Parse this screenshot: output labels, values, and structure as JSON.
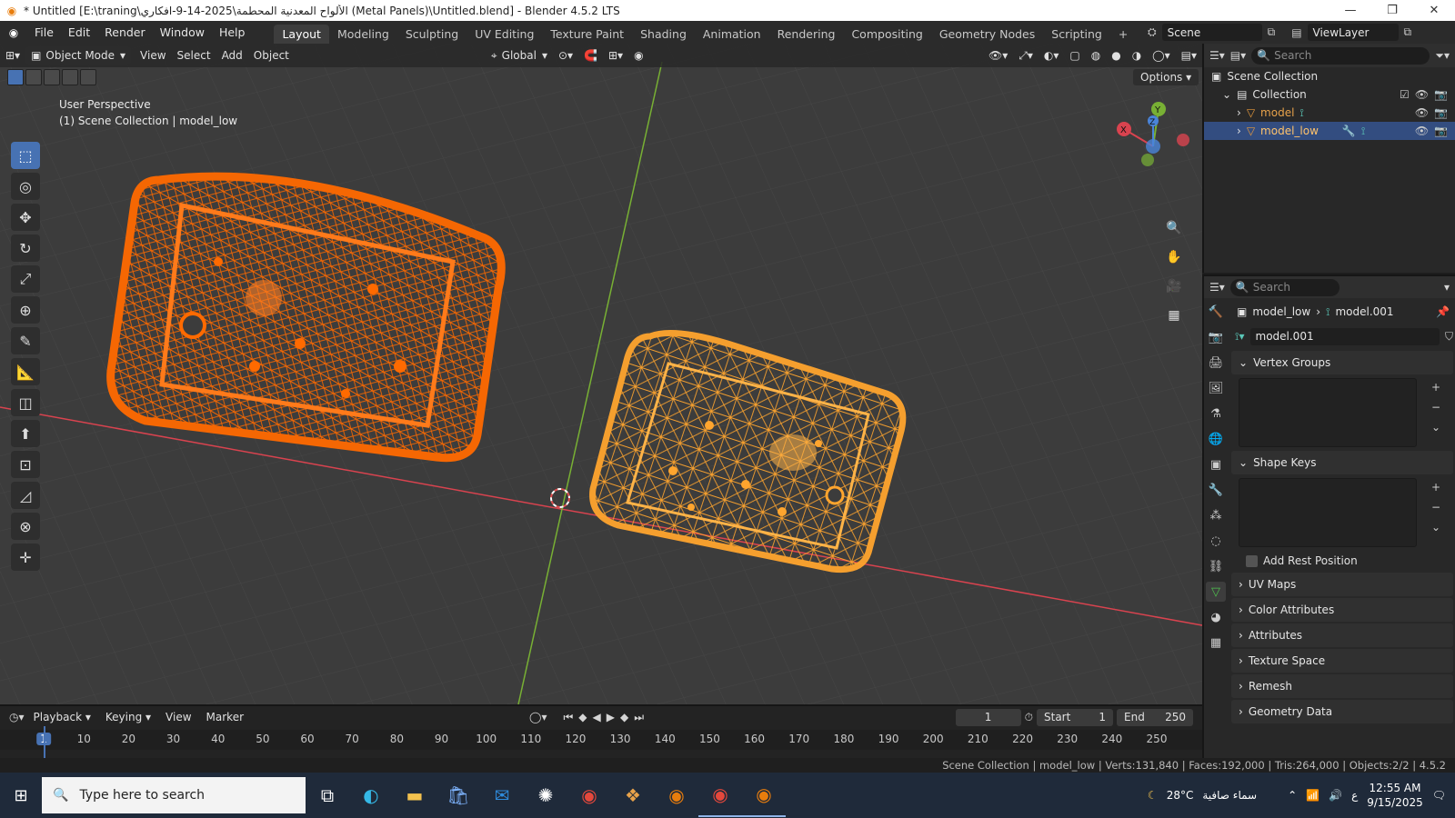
{
  "window": {
    "title": "* Untitled [E:\\traning\\الألواح المعدنية المحطمة\\2025-14-9-افكاري (Metal Panels)\\Untitled.blend] - Blender 4.5.2 LTS",
    "minimize": "—",
    "maximize": "❐",
    "close": "✕"
  },
  "menubar": {
    "items": [
      "File",
      "Edit",
      "Render",
      "Window",
      "Help"
    ]
  },
  "workspaces": {
    "tabs": [
      "Layout",
      "Modeling",
      "Sculpting",
      "UV Editing",
      "Texture Paint",
      "Shading",
      "Animation",
      "Rendering",
      "Compositing",
      "Geometry Nodes",
      "Scripting"
    ],
    "active": "Layout",
    "add": "+"
  },
  "scene": {
    "scene_name": "Scene",
    "view_layer": "ViewLayer"
  },
  "viewport": {
    "mode": "Object Mode",
    "menus": [
      "View",
      "Select",
      "Add",
      "Object"
    ],
    "orientation": "Global",
    "options_label": "Options",
    "info_line1": "User Perspective",
    "info_line2": "(1) Scene Collection | model_low",
    "colors": {
      "left_object": "#ff6a00",
      "right_object": "#ffa52e",
      "x_axis": "#d9434f",
      "y_axis": "#78b034",
      "background": "#3c3c3c"
    },
    "gizmo": {
      "x": "X",
      "y": "Y",
      "z": "Z"
    }
  },
  "toolbar": {
    "tools": [
      "select-box",
      "cursor",
      "move",
      "rotate",
      "scale",
      "transform",
      "annotate",
      "measure",
      "add-cube",
      "extrude",
      "scale-cage",
      "shear",
      "spin",
      "transform-gizmo"
    ],
    "glyphs": [
      "⬚",
      "◎",
      "✥",
      "↻",
      "⤢",
      "⊕",
      "✎",
      "📐",
      "◫",
      "⬆",
      "⊡",
      "◿",
      "⊗",
      "✛"
    ]
  },
  "outliner": {
    "search_placeholder": "Search",
    "scene_collection": "Scene Collection",
    "collection": "Collection",
    "items": [
      {
        "name": "model",
        "selected": false
      },
      {
        "name": "model_low",
        "selected": true
      }
    ]
  },
  "properties": {
    "search_placeholder": "Search",
    "breadcrumb_object": "model_low",
    "breadcrumb_mesh": "model.001",
    "mesh_name": "model.001",
    "panels": {
      "vertex_groups": "Vertex Groups",
      "shape_keys": "Shape Keys",
      "add_rest_position": "Add Rest Position",
      "uv_maps": "UV Maps",
      "color_attributes": "Color Attributes",
      "attributes": "Attributes",
      "texture_space": "Texture Space",
      "remesh": "Remesh",
      "geometry_data": "Geometry Data"
    }
  },
  "timeline": {
    "menus": [
      "Playback",
      "Keying",
      "View",
      "Marker"
    ],
    "current_frame": "1",
    "start_label": "Start",
    "start_value": "1",
    "end_label": "End",
    "end_value": "250",
    "ticks": [
      "1",
      "10",
      "20",
      "30",
      "40",
      "50",
      "60",
      "70",
      "80",
      "90",
      "100",
      "110",
      "120",
      "130",
      "140",
      "150",
      "160",
      "170",
      "180",
      "190",
      "200",
      "210",
      "220",
      "230",
      "240",
      "250"
    ]
  },
  "statusbar": {
    "text": "Scene Collection | model_low | Verts:131,840 | Faces:192,000 | Tris:264,000 | Objects:2/2 | 4.5.2"
  },
  "taskbar": {
    "search_placeholder": "Type here to search",
    "weather_temp": "28°C",
    "weather_desc": "سماء صافية",
    "lang": "ع",
    "time": "12:55 AM",
    "date": "9/15/2025"
  }
}
